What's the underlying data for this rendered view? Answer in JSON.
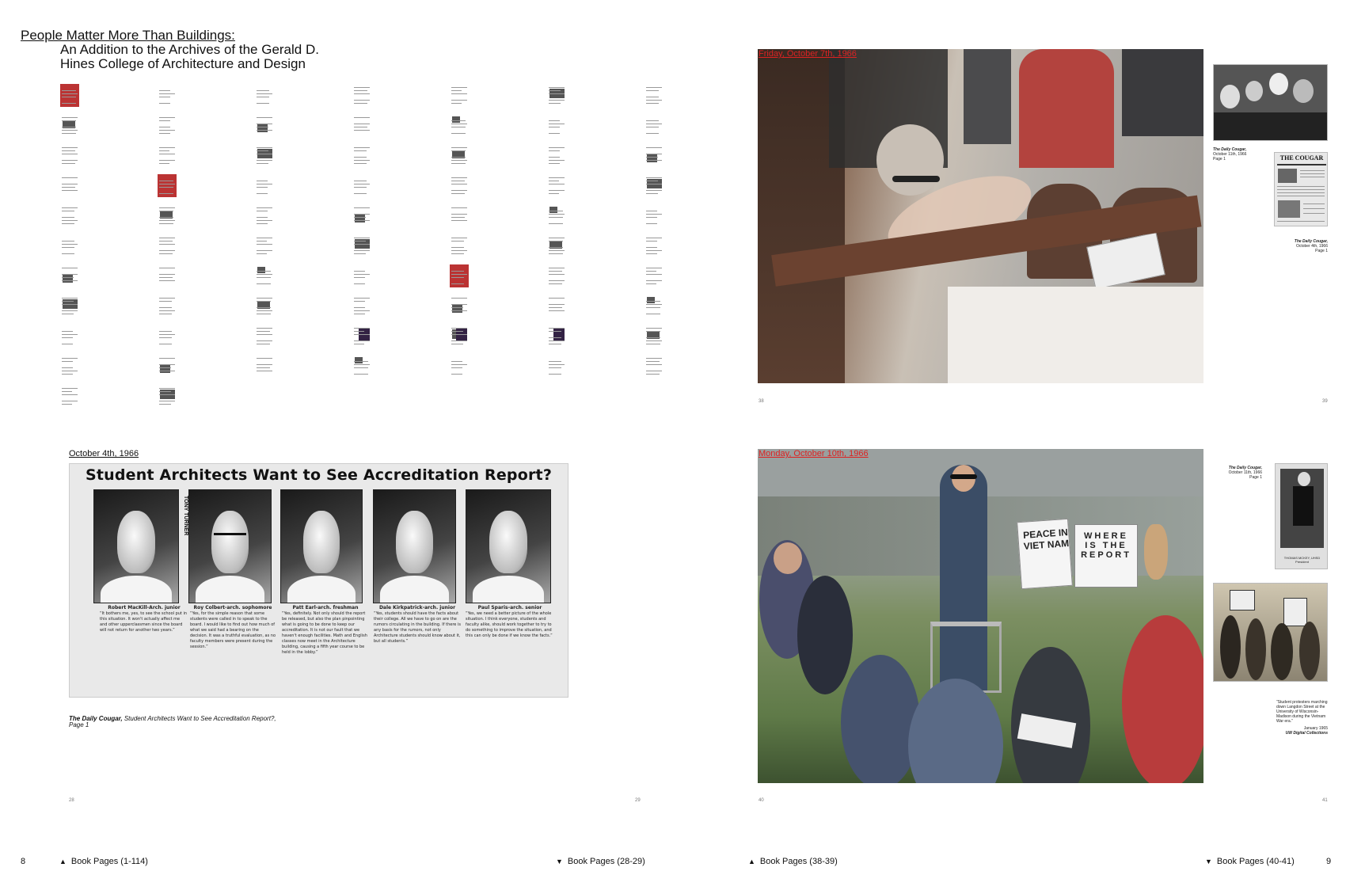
{
  "title": {
    "line1": "People Matter More Than Buildings:",
    "line2": "An Addition to the Archives of the Gerald D.",
    "line3": "Hines College of Architecture and Design"
  },
  "spreads": {
    "s28": {
      "date": "October 4th, 1966",
      "headline": "Student Architects Want to See Accreditation Report?",
      "vertical_credit": "TONY TURNER",
      "students": [
        {
          "name": "Robert MacKill-Arch. junior",
          "quote": "“It bothers me, yes, to see the school put in this situation. It won't actually affect me and other upperclassmen since the board will not return for another two years.”"
        },
        {
          "name": "Roy Colbert-arch. sophomore",
          "quote": "“Yes, for the simple reason that some students were called in to speak to the board. I would like to find out how much of what we said had a bearing on the decision. It was a truthful evaluation, as no faculty members were present during the session.”"
        },
        {
          "name": "Patt Earl-arch. freshman",
          "quote": "“Yes, definitely. Not only should the report be released, but also the plan pinpointing what is going to be done to keep our accreditation. It is not our fault that we haven't enough facilities. Math and English classes now meet in the Architecture building, causing a fifth year course to be held in the lobby.”"
        },
        {
          "name": "Dale Kirkpatrick-arch. junior",
          "quote": "“Yes, students should have the facts about their college. All we have to go on are the rumors circulating in the building. If there is any basis for the rumors, not only Architecture students should know about it, but all students.”"
        },
        {
          "name": "Paul Sparis-arch. senior",
          "quote": "“Yes, we need a better picture of the whole situation. I think everyone, students and faculty alike, should work together to try to do something to improve the situation, and this can only be done if we know the facts.”"
        }
      ],
      "citation_source": "The Daily Cougar,",
      "citation_title": "Student Architects Want to See Accreditation Report?,",
      "citation_page": "Page 1",
      "page_left": "28",
      "page_right": "29"
    },
    "s38": {
      "date": "Friday, October 7th, 1966",
      "caption1_source": "The Daily Cougar,",
      "caption1_date": "October 11th, 1966",
      "caption1_page": "Page 1",
      "caption2_source": "The Daily Cougar,",
      "caption2_date": "October 4th, 1966",
      "caption2_page": "Page 1",
      "masthead": "THE COUGAR",
      "page_left": "38",
      "page_right": "39"
    },
    "s40": {
      "date": "Monday, October 10th, 1966",
      "caption1_source": "The Daily Cougar,",
      "caption1_date": "October 11th, 1966",
      "caption1_page": "Page 1",
      "photo_credit": "THOMAS MCKEY, UHSD President",
      "sign1": "PEACE IN VIET NAM",
      "sign2": "WHERE IS THE REPORT",
      "quote": "“Student protesters marching down Langdon Street at the University of Wisconsin-Madison during the Vietnam War era.”",
      "quote_date": "January 1965",
      "quote_source": "UW Digital Collections",
      "page_left": "40",
      "page_right": "41"
    }
  },
  "footer": {
    "left_num": "8",
    "right_num": "9",
    "nav1": "Book Pages (1-114)",
    "nav2": "Book Pages (28-29)",
    "nav3": "Book Pages (38-39)",
    "nav4": "Book Pages (40-41)"
  }
}
